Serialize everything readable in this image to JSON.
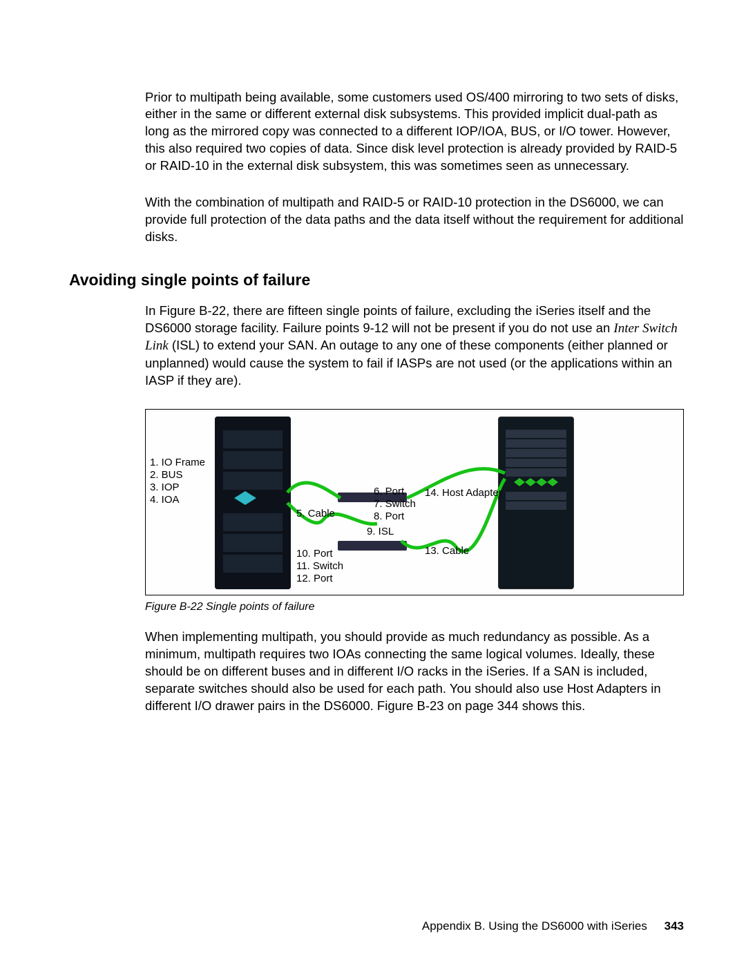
{
  "para1": "Prior to multipath being available, some customers used OS/400 mirroring to two sets of disks, either in the same or different external disk subsystems. This provided implicit dual-path as long as the mirrored copy was connected to a different IOP/IOA, BUS, or I/O tower. However, this also required two copies of data. Since disk level protection is already provided by RAID-5 or RAID-10 in the external disk subsystem, this was sometimes seen as unnecessary.",
  "para2": "With the combination of multipath and RAID-5 or RAID-10 protection in the DS6000, we can provide full protection of the data paths and the data itself without the requirement for additional disks.",
  "heading": "Avoiding single points of failure",
  "para3a": "In Figure B-22, there are fifteen single points of failure, excluding the iSeries itself and the DS6000 storage facility. Failure points 9-12 will not be present if you do not use an ",
  "para3em": "Inter Switch Link",
  "para3b": " (ISL) to extend your SAN. An outage to any one of these components (either planned or unplanned) would cause the system to fail if IASPs are not used (or the applications within an IASP if they are).",
  "figcaption": "Figure B-22   Single points of failure",
  "para4": "When implementing multipath, you should provide as much redundancy as possible. As a minimum, multipath requires two IOAs connecting the same logical volumes. Ideally, these should be on different buses and in different I/O racks in the iSeries. If a SAN is included, separate switches should also be used for each path. You should also use Host Adapters in different I/O drawer pairs in the DS6000. Figure B-23 on page 344 shows this.",
  "labels": {
    "l1": "1. IO Frame",
    "l2": "2. BUS",
    "l3": "3. IOP",
    "l4": "4. IOA",
    "l5": "5. Cable",
    "l6": "6. Port",
    "l7": "7. Switch",
    "l8": "8. Port",
    "l9": "9. ISL",
    "l10": "10. Port",
    "l11": "11. Switch",
    "l12": "12. Port",
    "l13": "13. Cable",
    "l14": "14. Host Adapter"
  },
  "footer": {
    "text": "Appendix B. Using the DS6000 with iSeries",
    "page": "343"
  }
}
